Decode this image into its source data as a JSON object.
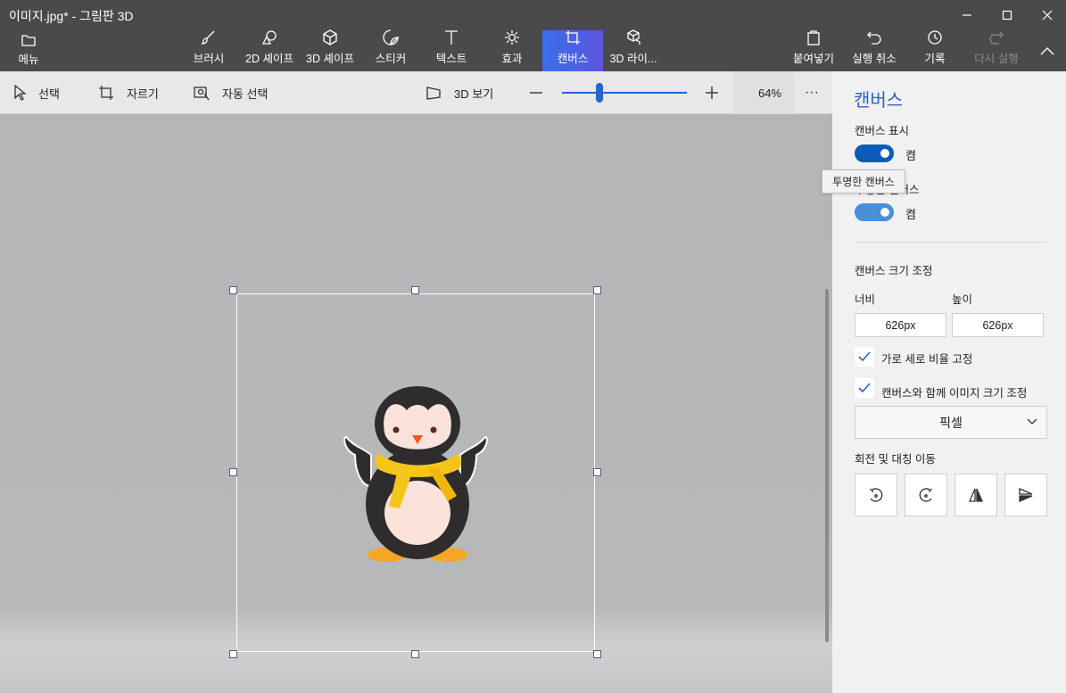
{
  "window": {
    "title": "이미지.jpg* - 그림판 3D"
  },
  "ribbon": {
    "menu": {
      "label": "메뉴",
      "icon": "folder-icon"
    },
    "tools": [
      {
        "label": "브러시",
        "icon": "brush-icon"
      },
      {
        "label": "2D 셰이프",
        "icon": "2d-shapes-icon"
      },
      {
        "label": "3D 셰이프",
        "icon": "3d-shapes-icon"
      },
      {
        "label": "스티커",
        "icon": "sticker-icon"
      },
      {
        "label": "텍스트",
        "icon": "text-icon"
      },
      {
        "label": "효과",
        "icon": "effects-icon"
      },
      {
        "label": "캔버스",
        "icon": "canvas-icon",
        "active": true
      },
      {
        "label": "3D 라이...",
        "icon": "3d-library-icon"
      }
    ],
    "actions": [
      {
        "label": "붙여넣기",
        "icon": "paste-icon"
      },
      {
        "label": "실행 취소",
        "icon": "undo-icon"
      },
      {
        "label": "기록",
        "icon": "history-icon"
      },
      {
        "label": "다시 실행",
        "icon": "redo-icon",
        "disabled": true
      }
    ]
  },
  "toolbar": {
    "select": "선택",
    "crop": "자르기",
    "magic_select": "자동 선택",
    "view_3d": "3D 보기",
    "zoom_percent": "64%",
    "zoom_fraction": 0.3,
    "more": "···"
  },
  "panel": {
    "title": "캔버스",
    "show_canvas": {
      "label": "캔버스 표시",
      "state": "켬"
    },
    "transparent_canvas": {
      "label": "투명한 캔버스",
      "state": "켬"
    },
    "resize": {
      "heading": "캔버스 크기 조정",
      "width_label": "너비",
      "height_label": "높이",
      "width_value": "626px",
      "height_value": "626px",
      "lock_aspect": "가로 세로 비율 고정",
      "resize_image": "캔버스와 함께 이미지 크기 조정",
      "unit": "픽셀"
    },
    "rotate_heading": "회전 및 대칭 이동"
  },
  "tooltip": "투명한 캔버스",
  "colors": {
    "accent": "#2a63c8",
    "ribbon_bg": "#4a4a4a",
    "canvas_bg": "#b8b9ba",
    "scarf": "#f5c518"
  }
}
